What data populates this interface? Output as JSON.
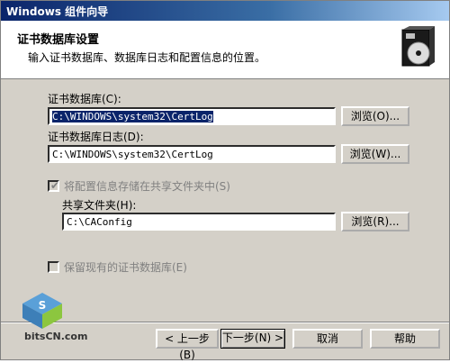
{
  "window": {
    "title": "Windows 组件向导"
  },
  "header": {
    "title": "证书数据库设置",
    "subtitle": "输入证书数据库、数据库日志和配置信息的位置。"
  },
  "fields": {
    "cert_db": {
      "label": "证书数据库(C):",
      "value": "C:\\WINDOWS\\system32\\CertLog",
      "browse_label": "浏览(O)..."
    },
    "cert_log": {
      "label": "证书数据库日志(D):",
      "value": "C:\\WINDOWS\\system32\\CertLog",
      "browse_label": "浏览(W)..."
    },
    "store_shared": {
      "label": "将配置信息存储在共享文件夹中(S)",
      "checked": true,
      "disabled": true
    },
    "shared_folder": {
      "label": "共享文件夹(H):",
      "value": "C:\\CAConfig",
      "browse_label": "浏览(R)..."
    },
    "keep_existing": {
      "label": "保留现有的证书数据库(E)",
      "checked": false,
      "disabled": true
    }
  },
  "footer": {
    "back_label": "< 上一步(B)",
    "next_label": "下一步(N) >",
    "cancel_label": "取消",
    "help_label": "帮助"
  },
  "watermark": "bitsCN.com"
}
